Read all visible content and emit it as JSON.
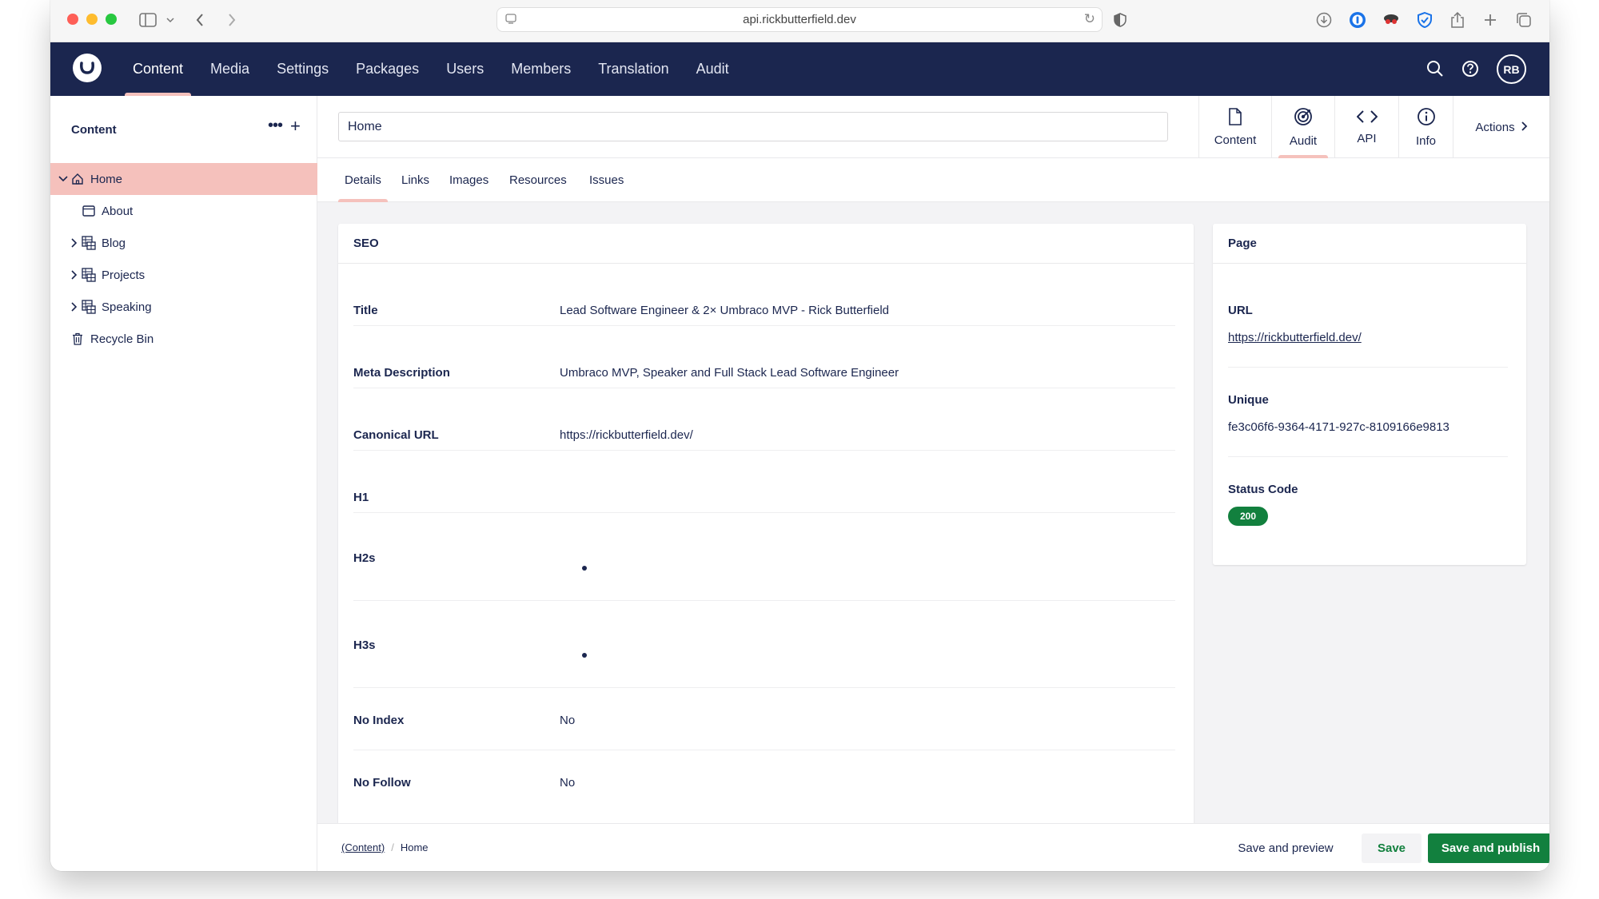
{
  "browser": {
    "url": "api.rickbutterfield.dev"
  },
  "topnav": {
    "items": [
      {
        "label": "Content"
      },
      {
        "label": "Media"
      },
      {
        "label": "Settings"
      },
      {
        "label": "Packages"
      },
      {
        "label": "Users"
      },
      {
        "label": "Members"
      },
      {
        "label": "Translation"
      },
      {
        "label": "Audit"
      }
    ],
    "active": "Content",
    "avatar_initials": "RB"
  },
  "sidebar": {
    "title": "Content",
    "tree": [
      {
        "label": "Home",
        "icon": "home-icon",
        "selected": true,
        "expanded": true
      },
      {
        "label": "About",
        "icon": "window-icon"
      },
      {
        "label": "Blog",
        "icon": "grid-list-icon"
      },
      {
        "label": "Projects",
        "icon": "grid-list-icon"
      },
      {
        "label": "Speaking",
        "icon": "grid-list-icon"
      },
      {
        "label": "Recycle Bin",
        "icon": "trash-icon"
      }
    ]
  },
  "editor": {
    "name_value": "Home",
    "apps": [
      {
        "label": "Content",
        "icon": "document-icon"
      },
      {
        "label": "Audit",
        "icon": "target-icon",
        "active": true
      },
      {
        "label": "API",
        "icon": "code-icon"
      },
      {
        "label": "Info",
        "icon": "info-icon"
      }
    ],
    "actions_label": "Actions",
    "tabs": [
      {
        "label": "Details",
        "active": true
      },
      {
        "label": "Links"
      },
      {
        "label": "Images"
      },
      {
        "label": "Resources"
      },
      {
        "label": "Issues"
      }
    ]
  },
  "seo": {
    "title": "SEO",
    "props": [
      {
        "label": "Title",
        "value": "Lead Software Engineer & 2× Umbraco MVP - Rick Butterfield"
      },
      {
        "label": "Meta Description",
        "value": "Umbraco MVP, Speaker and Full Stack Lead Software Engineer"
      },
      {
        "label": "Canonical URL",
        "value": "https://rickbutterfield.dev/"
      },
      {
        "label": "H1",
        "value": ""
      },
      {
        "label": "H2s",
        "value": ""
      },
      {
        "label": "H3s",
        "value": ""
      },
      {
        "label": "No Index",
        "value": "No"
      },
      {
        "label": "No Follow",
        "value": "No"
      }
    ]
  },
  "page_info": {
    "title": "Page",
    "url_label": "URL",
    "url_value": "https://rickbutterfield.dev/",
    "unique_label": "Unique",
    "unique_value": "fe3c06f6-9364-4171-927c-8109166e9813",
    "status_label": "Status Code",
    "status_value": "200"
  },
  "footer": {
    "breadcrumb_root": "(Content)",
    "breadcrumb_current": "Home",
    "save_preview_label": "Save and preview",
    "save_label": "Save",
    "publish_label": "Save and publish"
  },
  "colors": {
    "header_bg": "#1b264f",
    "active_accent": "#f5c1bc",
    "publish_green": "#12803e"
  }
}
